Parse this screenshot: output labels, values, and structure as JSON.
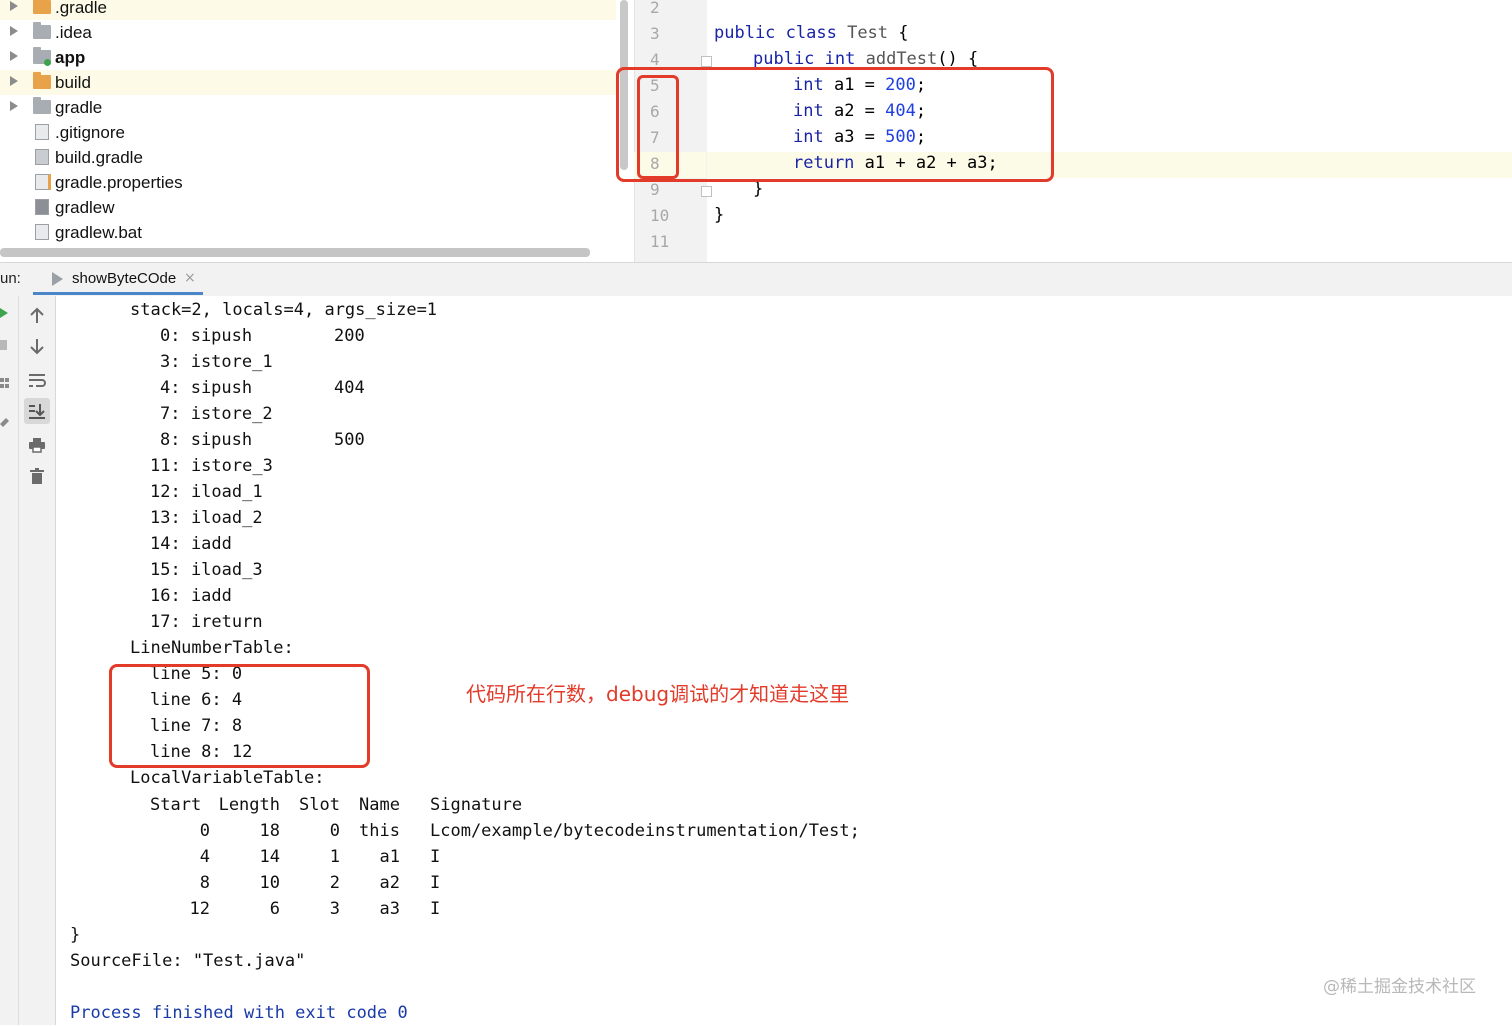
{
  "project_tree": {
    "items": [
      {
        "label": ".gradle",
        "type": "folder-orange",
        "expandable": true,
        "bold": false
      },
      {
        "label": ".idea",
        "type": "folder",
        "expandable": true,
        "bold": false
      },
      {
        "label": "app",
        "type": "module-folder",
        "expandable": true,
        "bold": true
      },
      {
        "label": "build",
        "type": "folder-orange",
        "expandable": true,
        "bold": false
      },
      {
        "label": "gradle",
        "type": "folder",
        "expandable": true,
        "bold": false
      },
      {
        "label": ".gitignore",
        "type": "file",
        "expandable": false,
        "bold": false
      },
      {
        "label": "build.gradle",
        "type": "gradle-file",
        "expandable": false,
        "bold": false
      },
      {
        "label": "gradle.properties",
        "type": "properties-file",
        "expandable": false,
        "bold": false
      },
      {
        "label": "gradlew",
        "type": "script-file",
        "expandable": false,
        "bold": false
      },
      {
        "label": "gradlew.bat",
        "type": "text-file",
        "expandable": false,
        "bold": false
      }
    ]
  },
  "editor": {
    "line_numbers": [
      "2",
      "3",
      "4",
      "5",
      "6",
      "7",
      "8",
      "9",
      "10",
      "11"
    ],
    "code": {
      "l3_kw": "public class",
      "l3_name": "Test",
      "l3_end": " {",
      "l4_kw": "public int",
      "l4_name": "addTest",
      "l4_end": "() {",
      "l5_kw": "int",
      "l5_mid": " a1 = ",
      "l5_num": "200",
      "l6_kw": "int",
      "l6_mid": " a2 = ",
      "l6_num": "404",
      "l7_kw": "int",
      "l7_mid": " a3 = ",
      "l7_num": "500",
      "semicolon": ";",
      "l8_kw": "return",
      "l8_rest": " a1 + a2 + a3;",
      "l9": "}",
      "l10": "}"
    }
  },
  "run_panel": {
    "label": "un:",
    "tab_label": "showByteCOde",
    "tab_close": "×"
  },
  "console": {
    "lines": [
      "stack=2, locals=4, args_size=1",
      "0: sipush        200",
      "3: istore_1",
      "4: sipush        404",
      "7: istore_2",
      "8: sipush        500",
      "11: istore_3",
      "12: iload_1",
      "13: iload_2",
      "14: iadd",
      "15: iload_3",
      "16: iadd",
      "17: ireturn",
      "LineNumberTable:",
      "line 5: 0",
      "line 6: 4",
      "line 7: 8",
      "line 8: 12",
      "LocalVariableTable:"
    ],
    "lvt_headers": [
      "Start",
      "Length",
      "Slot",
      "Name",
      "Signature"
    ],
    "lvt_rows": [
      [
        "0",
        "18",
        "0",
        "this",
        "Lcom/example/bytecodeinstrumentation/Test;"
      ],
      [
        "4",
        "14",
        "1",
        "a1",
        "I"
      ],
      [
        "8",
        "10",
        "2",
        "a2",
        "I"
      ],
      [
        "12",
        "6",
        "3",
        "a3",
        "I"
      ]
    ],
    "closing_brace": "}",
    "source_file": "SourceFile: \"Test.java\"",
    "process_finished": "Process finished with exit code 0"
  },
  "annotation_text": "代码所在行数，debug调试的才知道走这里",
  "watermark": "@稀土掘金技术社区",
  "colors": {
    "annotation_red": "#e23b2a",
    "keyword_blue": "#1a24a8",
    "number_blue": "#1f3fe0",
    "tab_underline": "#4a86c8"
  },
  "toolbar_icons": [
    "up-arrow-icon",
    "down-arrow-icon",
    "soft-wrap-icon",
    "scroll-to-end-icon",
    "print-icon",
    "trash-icon"
  ]
}
